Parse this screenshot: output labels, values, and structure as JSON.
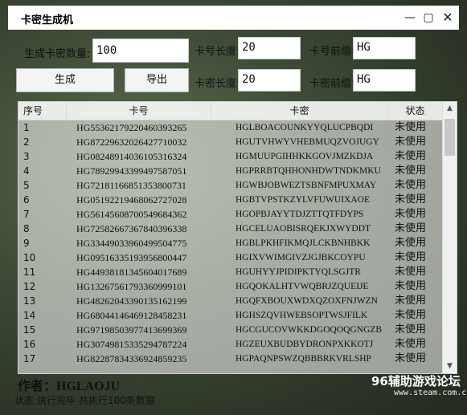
{
  "window": {
    "title": "卡密生成机"
  },
  "form": {
    "count_label": "生成卡密数量:",
    "count_value": "100",
    "card_len_label": "卡号长度:",
    "card_len_value": "20",
    "card_prefix_label": "卡号前缀:",
    "card_prefix_value": "HG",
    "pwd_len_label": "卡密长度:",
    "pwd_len_value": "20",
    "pwd_prefix_label": "卡密前缀:",
    "pwd_prefix_value": "HG",
    "generate_label": "生成",
    "export_label": "导出"
  },
  "table": {
    "headers": [
      "序号",
      "卡号",
      "卡密",
      "状态"
    ],
    "rows": [
      [
        "1",
        "HG55362179220460393265",
        "HGLBOACOUNKYYQLUCPBQDI",
        "未使用"
      ],
      [
        "2",
        "HG87229632026427710032",
        "HGUTVHWYVHEBMUQZVOJUGY",
        "未使用"
      ],
      [
        "3",
        "HG08248914036105316324",
        "HGMUUPGIHHKKGOVJMZKDJA",
        "未使用"
      ],
      [
        "4",
        "HG78929943399497587051",
        "HGPRRBTQHHONHDWTNDKMKU",
        "未使用"
      ],
      [
        "5",
        "HG72181166851353800731",
        "HGWBJOBWEZTSBNFMPUXMAY",
        "未使用"
      ],
      [
        "6",
        "HG05192219468062727028",
        "HGBTVPSTKZYLVFUWUIXAOE",
        "未使用"
      ],
      [
        "7",
        "HG56145608700549684362",
        "HGOPBJAYYTDJZTTQTFDYPS",
        "未使用"
      ],
      [
        "8",
        "HG72582667367840396338",
        "HGCELUAOBISRQEKJXWYDDT",
        "未使用"
      ],
      [
        "9",
        "HG33449033960499504775",
        "HGBLPKHFIKMQJLCKBNHBKK",
        "未使用"
      ],
      [
        "10",
        "HG09516335193956800447",
        "HGIXVWIMGIVZJGJBKCOYPU",
        "未使用"
      ],
      [
        "11",
        "HG44938181345604017689",
        "HGUHYYJPIDIPKTYQLSGJTR",
        "未使用"
      ],
      [
        "12",
        "HG13267561793360999101",
        "HGQOKALHTVWQBRJZQUEIJE",
        "未使用"
      ],
      [
        "13",
        "HG48262043390135162199",
        "HGQFXBOUXWDXQZOXFNJWZN",
        "未使用"
      ],
      [
        "14",
        "HG68044146469128458231",
        "HGHSZQVHWEBSOPTWSJFILK",
        "未使用"
      ],
      [
        "15",
        "HG97198503977413699369",
        "HGCGUCOVWKKDGOQOQGNGZB",
        "未使用"
      ],
      [
        "16",
        "HG30749815335294787224",
        "HGZEUXBUDBYDRONPXKKOTJ",
        "未使用"
      ],
      [
        "17",
        "HG82287834336924859235",
        "HGPAQNPSWZQBBBRKVRLSHP",
        "未使用"
      ]
    ]
  },
  "footer": {
    "author": "作者：HGLAOJU",
    "status": "状态:执行完毕 共执行100条数据"
  },
  "watermark": {
    "line1": "96辅助游戏论坛",
    "line2": "www.steam.com.cn"
  }
}
